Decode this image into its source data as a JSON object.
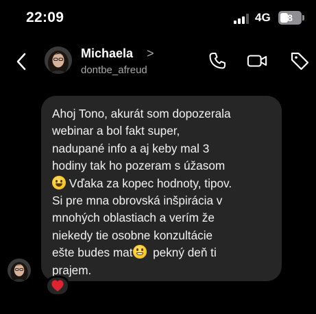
{
  "status_bar": {
    "time": "22:09",
    "network": "4G",
    "battery": "8",
    "battery_level": 0.08
  },
  "header": {
    "contact_name": "Michaela",
    "chevron": ">",
    "username": "dontbe_afreud"
  },
  "message": {
    "lines": [
      "Ahoj Tono, akurát som dopozerala",
      "webinar a bol fakt super,",
      "nadupané info a aj keby mal 3",
      "hodiny tak ho pozeram s úžasom",
      "Vďaka za kopec hodnoty, tipov.",
      "Si pre mna obrovská inšpirácia v",
      "mnohých oblastiach a verím že",
      "niekedy tie osobne konzultácie",
      "ešte budes mat",
      "pekný deň ti",
      "prajem."
    ],
    "emoji_1": "smiling-face-emoji",
    "emoji_2": "grinning-face-emoji",
    "reaction": "red-heart-emoji"
  },
  "colors": {
    "background": "#000000",
    "bubble": "#262626",
    "secondary_text": "#a8a8a8",
    "heart": "#e0232e"
  }
}
